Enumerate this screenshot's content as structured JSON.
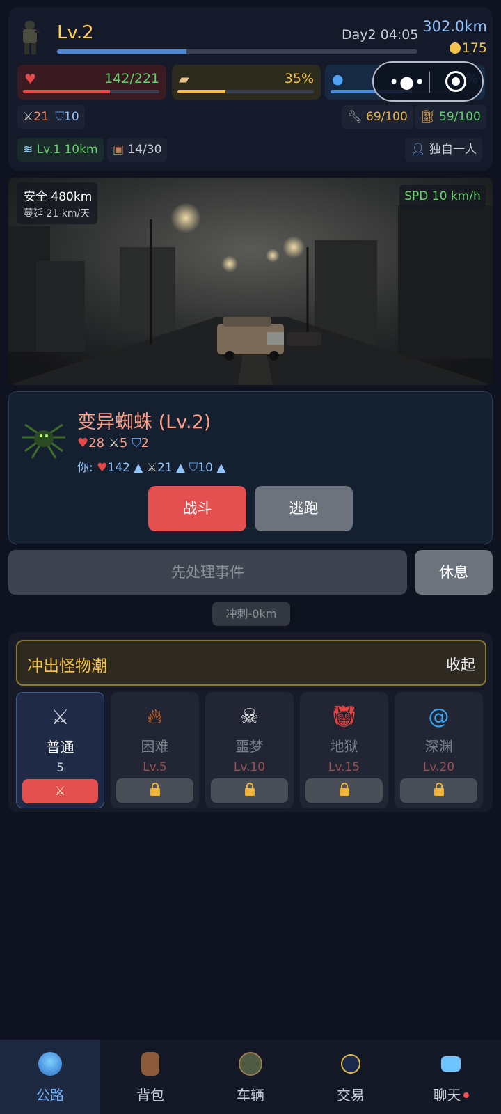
{
  "header": {
    "level": "Lv.2",
    "day_time": "Day2 04:05",
    "distance": "302.0km",
    "coins": "175",
    "xp_progress": 0.36
  },
  "vitals": {
    "health": {
      "value": "142/221",
      "fill": 0.64,
      "color": "#e54848"
    },
    "food": {
      "value": "35%",
      "fill": 0.35,
      "color": "#f0c23e"
    },
    "water": {
      "value": "%",
      "fill": 0.55,
      "color": "#4d88d6"
    }
  },
  "attributes": {
    "attack": "21",
    "defense": "10",
    "repair": "69/100",
    "fuel": "59/100",
    "speed_level": "Lv.1 10km",
    "cargo": "14/30",
    "party": "独自一人"
  },
  "scene": {
    "safe_zone": "安全 480km",
    "spread": "蔓延 21 km/天",
    "speed": "SPD 10 km/h"
  },
  "encounter": {
    "enemy_name": "变异蜘蛛 (Lv.2)",
    "enemy_hp": "28",
    "enemy_atk": "5",
    "enemy_def": "2",
    "you_label": "你:",
    "you_hp": "142",
    "you_atk": "21",
    "you_def": "10",
    "fight_label": "战斗",
    "flee_label": "逃跑"
  },
  "actions": {
    "event_label": "先处理事件",
    "rest_label": "休息",
    "sprint_label": "冲刺-0km"
  },
  "horde": {
    "title": "冲出怪物潮",
    "collapse_label": "收起",
    "difficulties": [
      {
        "name": "普通",
        "req": "5",
        "icon": "crossed-swords-icon"
      },
      {
        "name": "困难",
        "req": "Lv.5",
        "icon": "fire-icon"
      },
      {
        "name": "噩梦",
        "req": "Lv.10",
        "icon": "skull-icon"
      },
      {
        "name": "地狱",
        "req": "Lv.15",
        "icon": "oni-mask-icon"
      },
      {
        "name": "深渊",
        "req": "Lv.20",
        "icon": "vortex-icon"
      }
    ]
  },
  "nav": {
    "items": [
      {
        "label": "公路",
        "icon": "road-globe-icon"
      },
      {
        "label": "背包",
        "icon": "backpack-icon"
      },
      {
        "label": "车辆",
        "icon": "vehicle-icon"
      },
      {
        "label": "交易",
        "icon": "trade-icon"
      },
      {
        "label": "聊天",
        "icon": "chat-icon"
      }
    ]
  }
}
